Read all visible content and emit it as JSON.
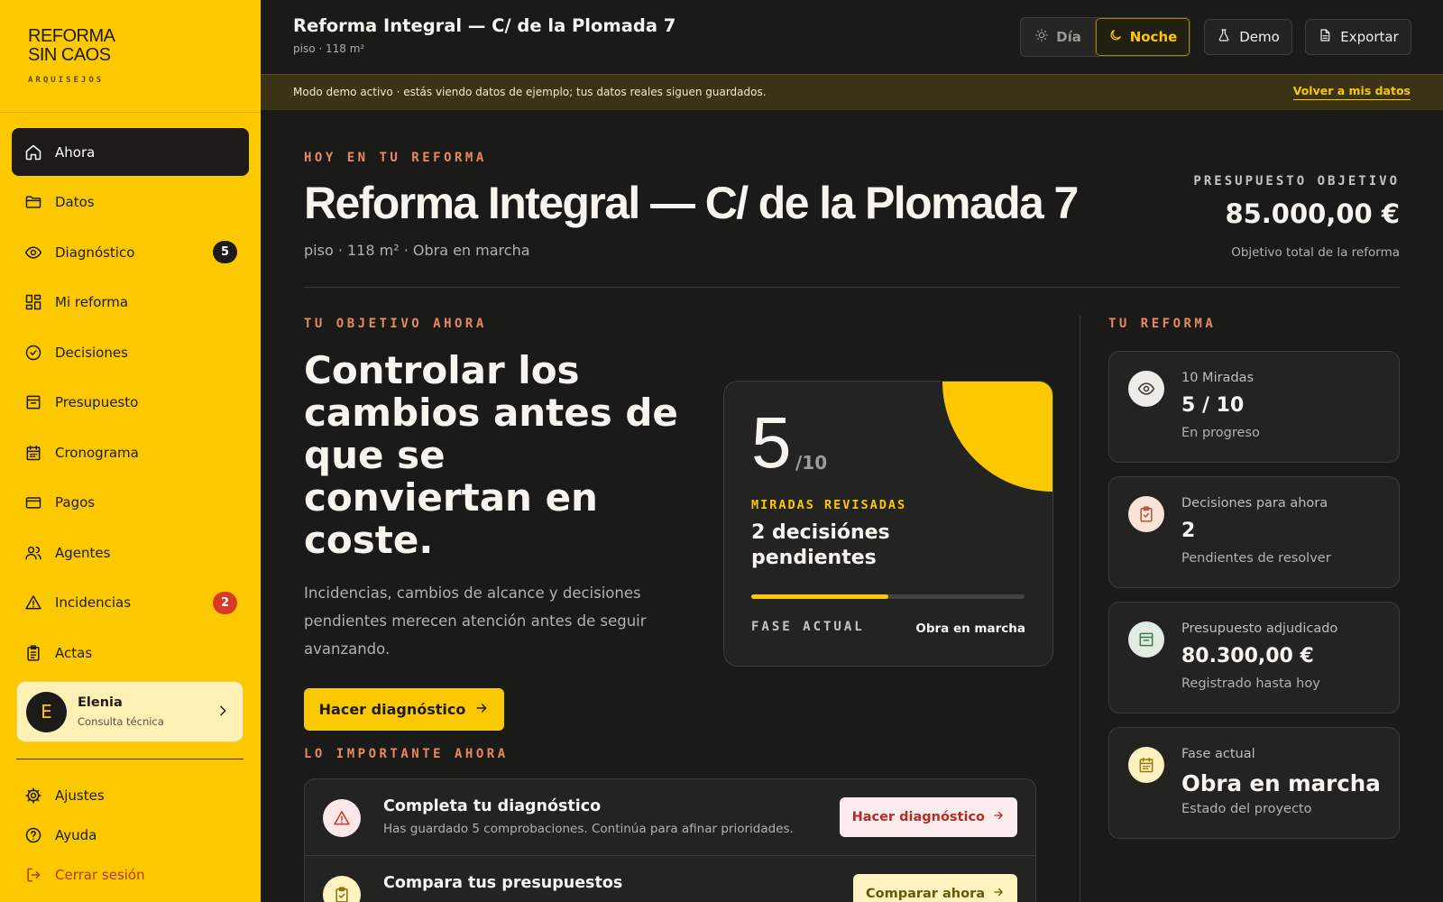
{
  "brand": {
    "name_line1": "REFORMA",
    "name_line2": "SIN CAOS",
    "subtitle": "ARQUISEJOS"
  },
  "nav": [
    {
      "label": "Ahora",
      "icon": "home-icon",
      "active": true
    },
    {
      "label": "Datos",
      "icon": "folder-icon"
    },
    {
      "label": "Diagnóstico",
      "icon": "eye-icon",
      "badge": "5"
    },
    {
      "label": "Mi reforma",
      "icon": "grid-icon"
    },
    {
      "label": "Decisiones",
      "icon": "check-circle-icon"
    },
    {
      "label": "Presupuesto",
      "icon": "archive-icon"
    },
    {
      "label": "Cronograma",
      "icon": "calendar-icon"
    },
    {
      "label": "Pagos",
      "icon": "credit-card-icon"
    },
    {
      "label": "Agentes",
      "icon": "users-icon"
    },
    {
      "label": "Incidencias",
      "icon": "alert-triangle-icon",
      "badge": "2"
    },
    {
      "label": "Actas",
      "icon": "clipboard-icon"
    }
  ],
  "user": {
    "initial": "E",
    "name": "Elenia",
    "role": "Consulta técnica"
  },
  "bottom_nav": [
    {
      "label": "Ajustes",
      "icon": "gear-icon"
    },
    {
      "label": "Ayuda",
      "icon": "help-circle-icon"
    },
    {
      "label": "Cerrar sesión",
      "icon": "logout-icon"
    }
  ],
  "topbar": {
    "title": "Reforma Integral — C/ de la Plomada 7",
    "subtitle": "piso · 118 m²",
    "theme_day": "Día",
    "theme_night": "Noche",
    "demo": "Demo",
    "export": "Exportar"
  },
  "banner": {
    "text": "Modo demo activo · estás viendo datos de ejemplo; tus datos reales siguen guardados.",
    "link": "Volver a mis datos"
  },
  "hero": {
    "eyebrow": "HOY EN TU REFORMA",
    "title": "Reforma Integral — C/ de la Plomada 7",
    "subtitle": "piso · 118 m² · Obra en marcha",
    "budget_eyebrow": "PRESUPUESTO OBJETIVO",
    "budget_value": "85.000,00 €",
    "budget_caption": "Objetivo total de la reforma"
  },
  "goal": {
    "eyebrow": "TU OBJETIVO AHORA",
    "title": "Controlar los cambios antes de que se conviertan en coste.",
    "description": "Incidencias, cambios de alcance y decisiones pendientes merecen atención antes de seguir avanzando.",
    "cta": "Hacer diagnóstico"
  },
  "score": {
    "value": "5",
    "denominator": "/10",
    "label": "MIRADAS REVISADAS",
    "pending": "2 decisiónes pendientes",
    "progress_fraction": 0.5,
    "phase_label": "FASE ACTUAL",
    "phase_value": "Obra en marcha"
  },
  "important": {
    "eyebrow": "LO IMPORTANTE AHORA",
    "tasks": [
      {
        "title": "Completa tu diagnóstico",
        "description": "Has guardado 5 comprobaciones. Continúa para afinar prioridades.",
        "button": "Hacer diagnóstico",
        "icon": "alert-triangle-icon"
      },
      {
        "title": "Compara tus presupuestos",
        "description": "",
        "button": "Comparar ahora",
        "icon": "clipboard-check-icon"
      }
    ]
  },
  "side": {
    "eyebrow": "TU REFORMA",
    "cards": [
      {
        "label": "10 Miradas",
        "value": "5 / 10",
        "caption": "En progreso",
        "icon": "eye-icon"
      },
      {
        "label": "Decisiones para ahora",
        "value": "2",
        "caption": "Pendientes de resolver",
        "icon": "clipboard-check-icon"
      },
      {
        "label": "Presupuesto adjudicado",
        "value": "80.300,00 €",
        "caption": "Registrado hasta hoy",
        "icon": "archive-icon"
      },
      {
        "label": "Fase actual",
        "value": "Obra en marcha",
        "caption": "Estado del proyecto",
        "icon": "calendar-icon"
      }
    ]
  },
  "colors": {
    "accent": "#fcc800",
    "background": "#1a1a19",
    "card": "#232322",
    "eyebrow": "#e8895f",
    "danger": "#d93a26"
  }
}
